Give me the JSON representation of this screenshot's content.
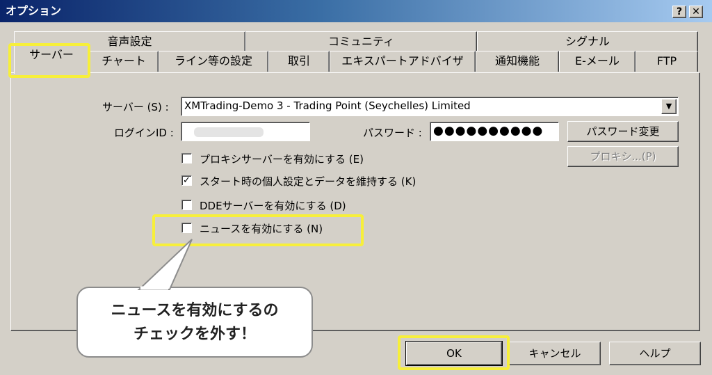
{
  "window": {
    "title": "オプション",
    "help_btn": "?",
    "close_btn": "✕"
  },
  "tabs_row1": [
    "音声設定",
    "コミュニティ",
    "シグナル"
  ],
  "tabs_row2": [
    "サーバー",
    "チャート",
    "ライン等の設定",
    "取引",
    "エキスパートアドバイザ",
    "通知機能",
    "E-メール",
    "FTP"
  ],
  "server": {
    "server_label": "サーバー (S) :",
    "server_value": "XMTrading-Demo 3 - Trading Point (Seychelles) Limited",
    "login_label": "ログインID :",
    "password_label": "パスワード :",
    "password_value": "●●●●●●●●●●",
    "change_password_btn": "パスワード変更",
    "proxy_btn": "プロキシ...(P)",
    "checkboxes": [
      {
        "label": "プロキシサーバーを有効にする (E)",
        "checked": false
      },
      {
        "label": "スタート時の個人設定とデータを維持する (K)",
        "checked": true
      },
      {
        "label": "DDEサーバーを有効にする (D)",
        "checked": false
      },
      {
        "label": "ニュースを有効にする (N)",
        "checked": false
      }
    ]
  },
  "buttons": {
    "ok": "OK",
    "cancel": "キャンセル",
    "help": "ヘルプ"
  },
  "callout": {
    "line1": "ニュースを有効にするの",
    "line2": "チェックを外す！"
  },
  "colors": {
    "highlight": "#f7ef3a",
    "titlebar": "#0a246a"
  }
}
